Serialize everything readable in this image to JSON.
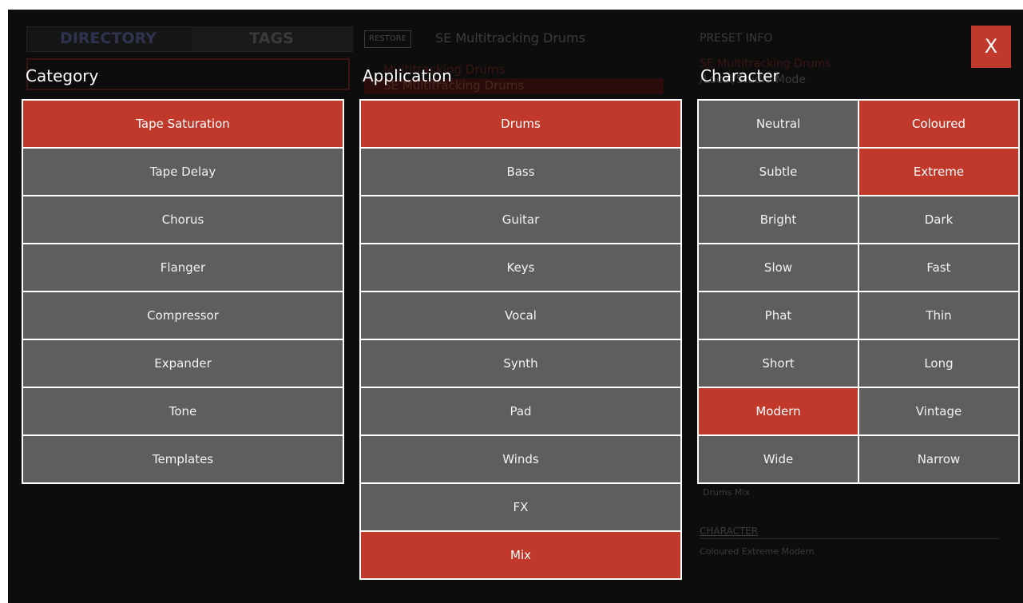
{
  "background": {
    "tab_directory": "DIRECTORY",
    "tab_tags": "TAGS",
    "restore_label": "RESTORE",
    "preset_title": "SE Multitracking Drums",
    "list_item_1": "Multitracking Drums",
    "list_item_2": "SE Multitracking Drums",
    "preset_info_label": "PRESET INFO",
    "preset_info_line1": "SE Multitracking Drums",
    "preset_info_line2": "/Local/Studio Mode",
    "tag_values": "Drums  Mix",
    "character_label": "CHARACTER",
    "character_values": "Coloured  Extreme  Modern"
  },
  "close_label": "X",
  "headers": {
    "category": "Category",
    "application": "Application",
    "character": "Character"
  },
  "category": [
    {
      "label": "Tape Saturation",
      "selected": true
    },
    {
      "label": "Tape Delay",
      "selected": false
    },
    {
      "label": "Chorus",
      "selected": false
    },
    {
      "label": "Flanger",
      "selected": false
    },
    {
      "label": "Compressor",
      "selected": false
    },
    {
      "label": "Expander",
      "selected": false
    },
    {
      "label": "Tone",
      "selected": false
    },
    {
      "label": "Templates",
      "selected": false
    }
  ],
  "application": [
    {
      "label": "Drums",
      "selected": true
    },
    {
      "label": "Bass",
      "selected": false
    },
    {
      "label": "Guitar",
      "selected": false
    },
    {
      "label": "Keys",
      "selected": false
    },
    {
      "label": "Vocal",
      "selected": false
    },
    {
      "label": "Synth",
      "selected": false
    },
    {
      "label": "Pad",
      "selected": false
    },
    {
      "label": "Winds",
      "selected": false
    },
    {
      "label": "FX",
      "selected": false
    },
    {
      "label": "Mix",
      "selected": true
    }
  ],
  "character": [
    {
      "label": "Neutral",
      "selected": false
    },
    {
      "label": "Coloured",
      "selected": true
    },
    {
      "label": "Subtle",
      "selected": false
    },
    {
      "label": "Extreme",
      "selected": true
    },
    {
      "label": "Bright",
      "selected": false
    },
    {
      "label": "Dark",
      "selected": false
    },
    {
      "label": "Slow",
      "selected": false
    },
    {
      "label": "Fast",
      "selected": false
    },
    {
      "label": "Phat",
      "selected": false
    },
    {
      "label": "Thin",
      "selected": false
    },
    {
      "label": "Short",
      "selected": false
    },
    {
      "label": "Long",
      "selected": false
    },
    {
      "label": "Modern",
      "selected": true
    },
    {
      "label": "Vintage",
      "selected": false
    },
    {
      "label": "Wide",
      "selected": false
    },
    {
      "label": "Narrow",
      "selected": false
    }
  ],
  "colors": {
    "selected": "#c0392b",
    "unselected": "#5e5e5e",
    "background": "#0d0d0d"
  }
}
